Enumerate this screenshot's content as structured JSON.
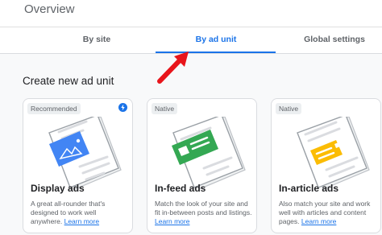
{
  "header": {
    "title": "Overview"
  },
  "tabs": [
    {
      "label": "By site",
      "active": false
    },
    {
      "label": "By ad unit",
      "active": true
    },
    {
      "label": "Global settings",
      "active": false
    }
  ],
  "section": {
    "title": "Create new ad unit"
  },
  "cards": [
    {
      "badge": "Recommended",
      "title": "Display ads",
      "desc": "A great all-rounder that's designed to work well anywhere.",
      "link": "Learn more",
      "accent": "#4285f4"
    },
    {
      "badge": "Native",
      "title": "In-feed ads",
      "desc": "Match the look of your site and fit in-between posts and listings.",
      "link": "Learn more",
      "accent": "#34a853"
    },
    {
      "badge": "Native",
      "title": "In-article ads",
      "desc": "Also match your site and work well with articles and content pages.",
      "link": "Learn more",
      "accent": "#fbbc04"
    }
  ],
  "colors": {
    "primary": "#1a73e8",
    "arrow": "#e8151b"
  }
}
